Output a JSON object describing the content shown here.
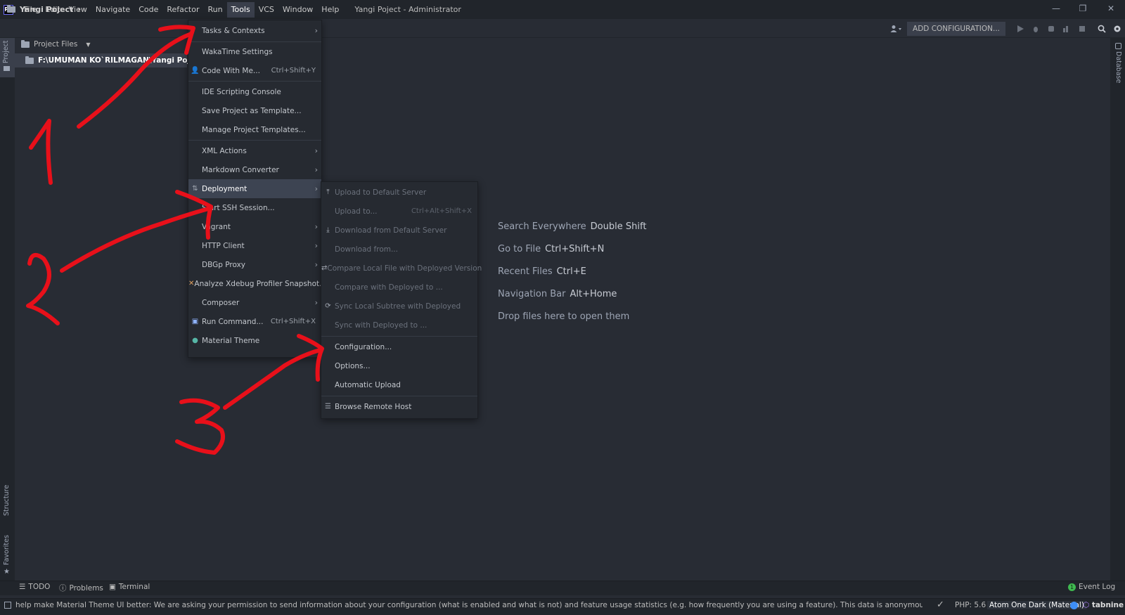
{
  "app": {
    "logo": "PS",
    "window_title": "Yangi Poject - Administrator"
  },
  "menu": [
    "File",
    "Edit",
    "View",
    "Navigate",
    "Code",
    "Refactor",
    "Run",
    "Tools",
    "VCS",
    "Window",
    "Help"
  ],
  "active_menu": "Tools",
  "window_controls": {
    "minimize": "—",
    "restore": "❐",
    "close": "✕"
  },
  "navbar": {
    "breadcrumb": "Yangi Poject",
    "breadcrumb_arrow": "›",
    "add_configuration": "ADD CONFIGURATION..."
  },
  "stripes": {
    "project": "Project",
    "structure": "Structure",
    "favorites": "Favorites",
    "database": "Database"
  },
  "project_panel": {
    "header": "Project Files",
    "root": "F:\\UMUMAN KO`RILMAGAN\\Yangi Poject"
  },
  "tools_menu": [
    {
      "label": "Tasks & Contexts",
      "submenu": true
    },
    {
      "label": "WakaTime Settings"
    },
    {
      "label": "Code With Me...",
      "shortcut": "Ctrl+Shift+Y",
      "icon": "users-icon"
    },
    {
      "label": "IDE Scripting Console"
    },
    {
      "label": "Save Project as Template..."
    },
    {
      "label": "Manage Project Templates..."
    },
    {
      "label": "XML Actions",
      "submenu": true
    },
    {
      "label": "Markdown Converter",
      "submenu": true
    },
    {
      "label": "Deployment",
      "submenu": true,
      "selected": true,
      "icon": "deployment-icon"
    },
    {
      "label": "Start SSH Session..."
    },
    {
      "label": "Vagrant",
      "submenu": true
    },
    {
      "label": "HTTP Client",
      "submenu": true
    },
    {
      "label": "DBGp Proxy",
      "submenu": true
    },
    {
      "label": "Analyze Xdebug Profiler Snapshot...",
      "icon": "xdebug-icon"
    },
    {
      "label": "Composer",
      "submenu": true
    },
    {
      "label": "Run Command...",
      "shortcut": "Ctrl+Shift+X",
      "icon": "terminal-icon"
    },
    {
      "label": "Material Theme",
      "icon": "material-theme-icon"
    }
  ],
  "deployment_menu": [
    {
      "label": "Upload to Default Server",
      "disabled": true,
      "icon": "upload-icon"
    },
    {
      "label": "Upload to...",
      "shortcut": "Ctrl+Alt+Shift+X",
      "disabled": true
    },
    {
      "label": "Download from Default Server",
      "disabled": true,
      "icon": "download-icon"
    },
    {
      "label": "Download from...",
      "disabled": true
    },
    {
      "label": "Compare Local File with Deployed Version",
      "disabled": true,
      "icon": "compare-icon"
    },
    {
      "label": "Compare with Deployed to ...",
      "disabled": true
    },
    {
      "label": "Sync Local Subtree with Deployed",
      "disabled": true,
      "icon": "sync-icon"
    },
    {
      "label": "Sync with Deployed to ...",
      "disabled": true
    },
    {
      "label": "Configuration..."
    },
    {
      "label": "Options..."
    },
    {
      "label": "Automatic Upload"
    },
    {
      "label": "Browse Remote Host",
      "icon": "remote-host-icon"
    }
  ],
  "editor_hints": [
    {
      "text": "Search Everywhere",
      "key": "Double Shift"
    },
    {
      "text": "Go to File",
      "key": "Ctrl+Shift+N"
    },
    {
      "text": "Recent Files",
      "key": "Ctrl+E"
    },
    {
      "text": "Navigation Bar",
      "key": "Alt+Home"
    },
    {
      "text": "Drop files here to open them",
      "key": ""
    }
  ],
  "bottom_tabs": {
    "todo": "TODO",
    "problems": "Problems",
    "terminal": "Terminal",
    "event_log": "Event Log",
    "event_count": "1"
  },
  "status": {
    "message": "help make Material Theme UI better: We are asking your permission to send information about your configuration (what is enabled and what is not) and feature usage statistics (e.g. how frequently you are using a feature). This data is anonymous, does not contain any persona... (a minute ago)",
    "php": "PHP: 5.6",
    "theme": "Atom One Dark (Material)",
    "tabnine": "tabnine"
  },
  "colors": {
    "background": "#282c34",
    "chrome": "#21252b",
    "selection": "#3d4452",
    "annotation": "#e8101a"
  }
}
